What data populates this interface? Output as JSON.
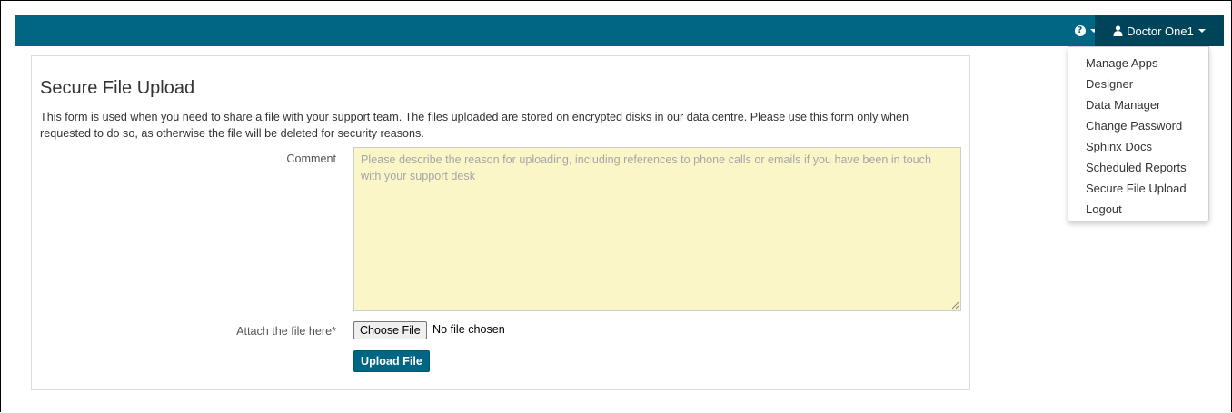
{
  "navbar": {
    "help_icon": "question-circle-icon",
    "user_icon": "user-icon",
    "user_name": "Doctor One1",
    "accent_color": "#006683",
    "active_color": "#004459"
  },
  "user_menu": {
    "items": [
      {
        "label": "Manage Apps"
      },
      {
        "label": "Designer"
      },
      {
        "label": "Data Manager"
      },
      {
        "label": "Change Password"
      },
      {
        "label": "Sphinx Docs"
      },
      {
        "label": "Scheduled Reports"
      },
      {
        "label": "Secure File Upload"
      },
      {
        "label": "Logout"
      }
    ]
  },
  "form": {
    "title": "Secure File Upload",
    "description": "This form is used when you need to share a file with your support team. The files uploaded are stored on encrypted disks in our data centre. Please use this form only when requested to do so, as otherwise the file will be deleted for security reasons.",
    "comment_label": "Comment",
    "comment_value": "",
    "comment_placeholder": "Please describe the reason for uploading, including references to phone calls or emails if you have been in touch with your support desk",
    "attach_label": "Attach the file here*",
    "choose_file_label": "Choose File",
    "no_file_text": "No file chosen",
    "upload_label": "Upload File",
    "textarea_color": "#fbf6c8"
  }
}
